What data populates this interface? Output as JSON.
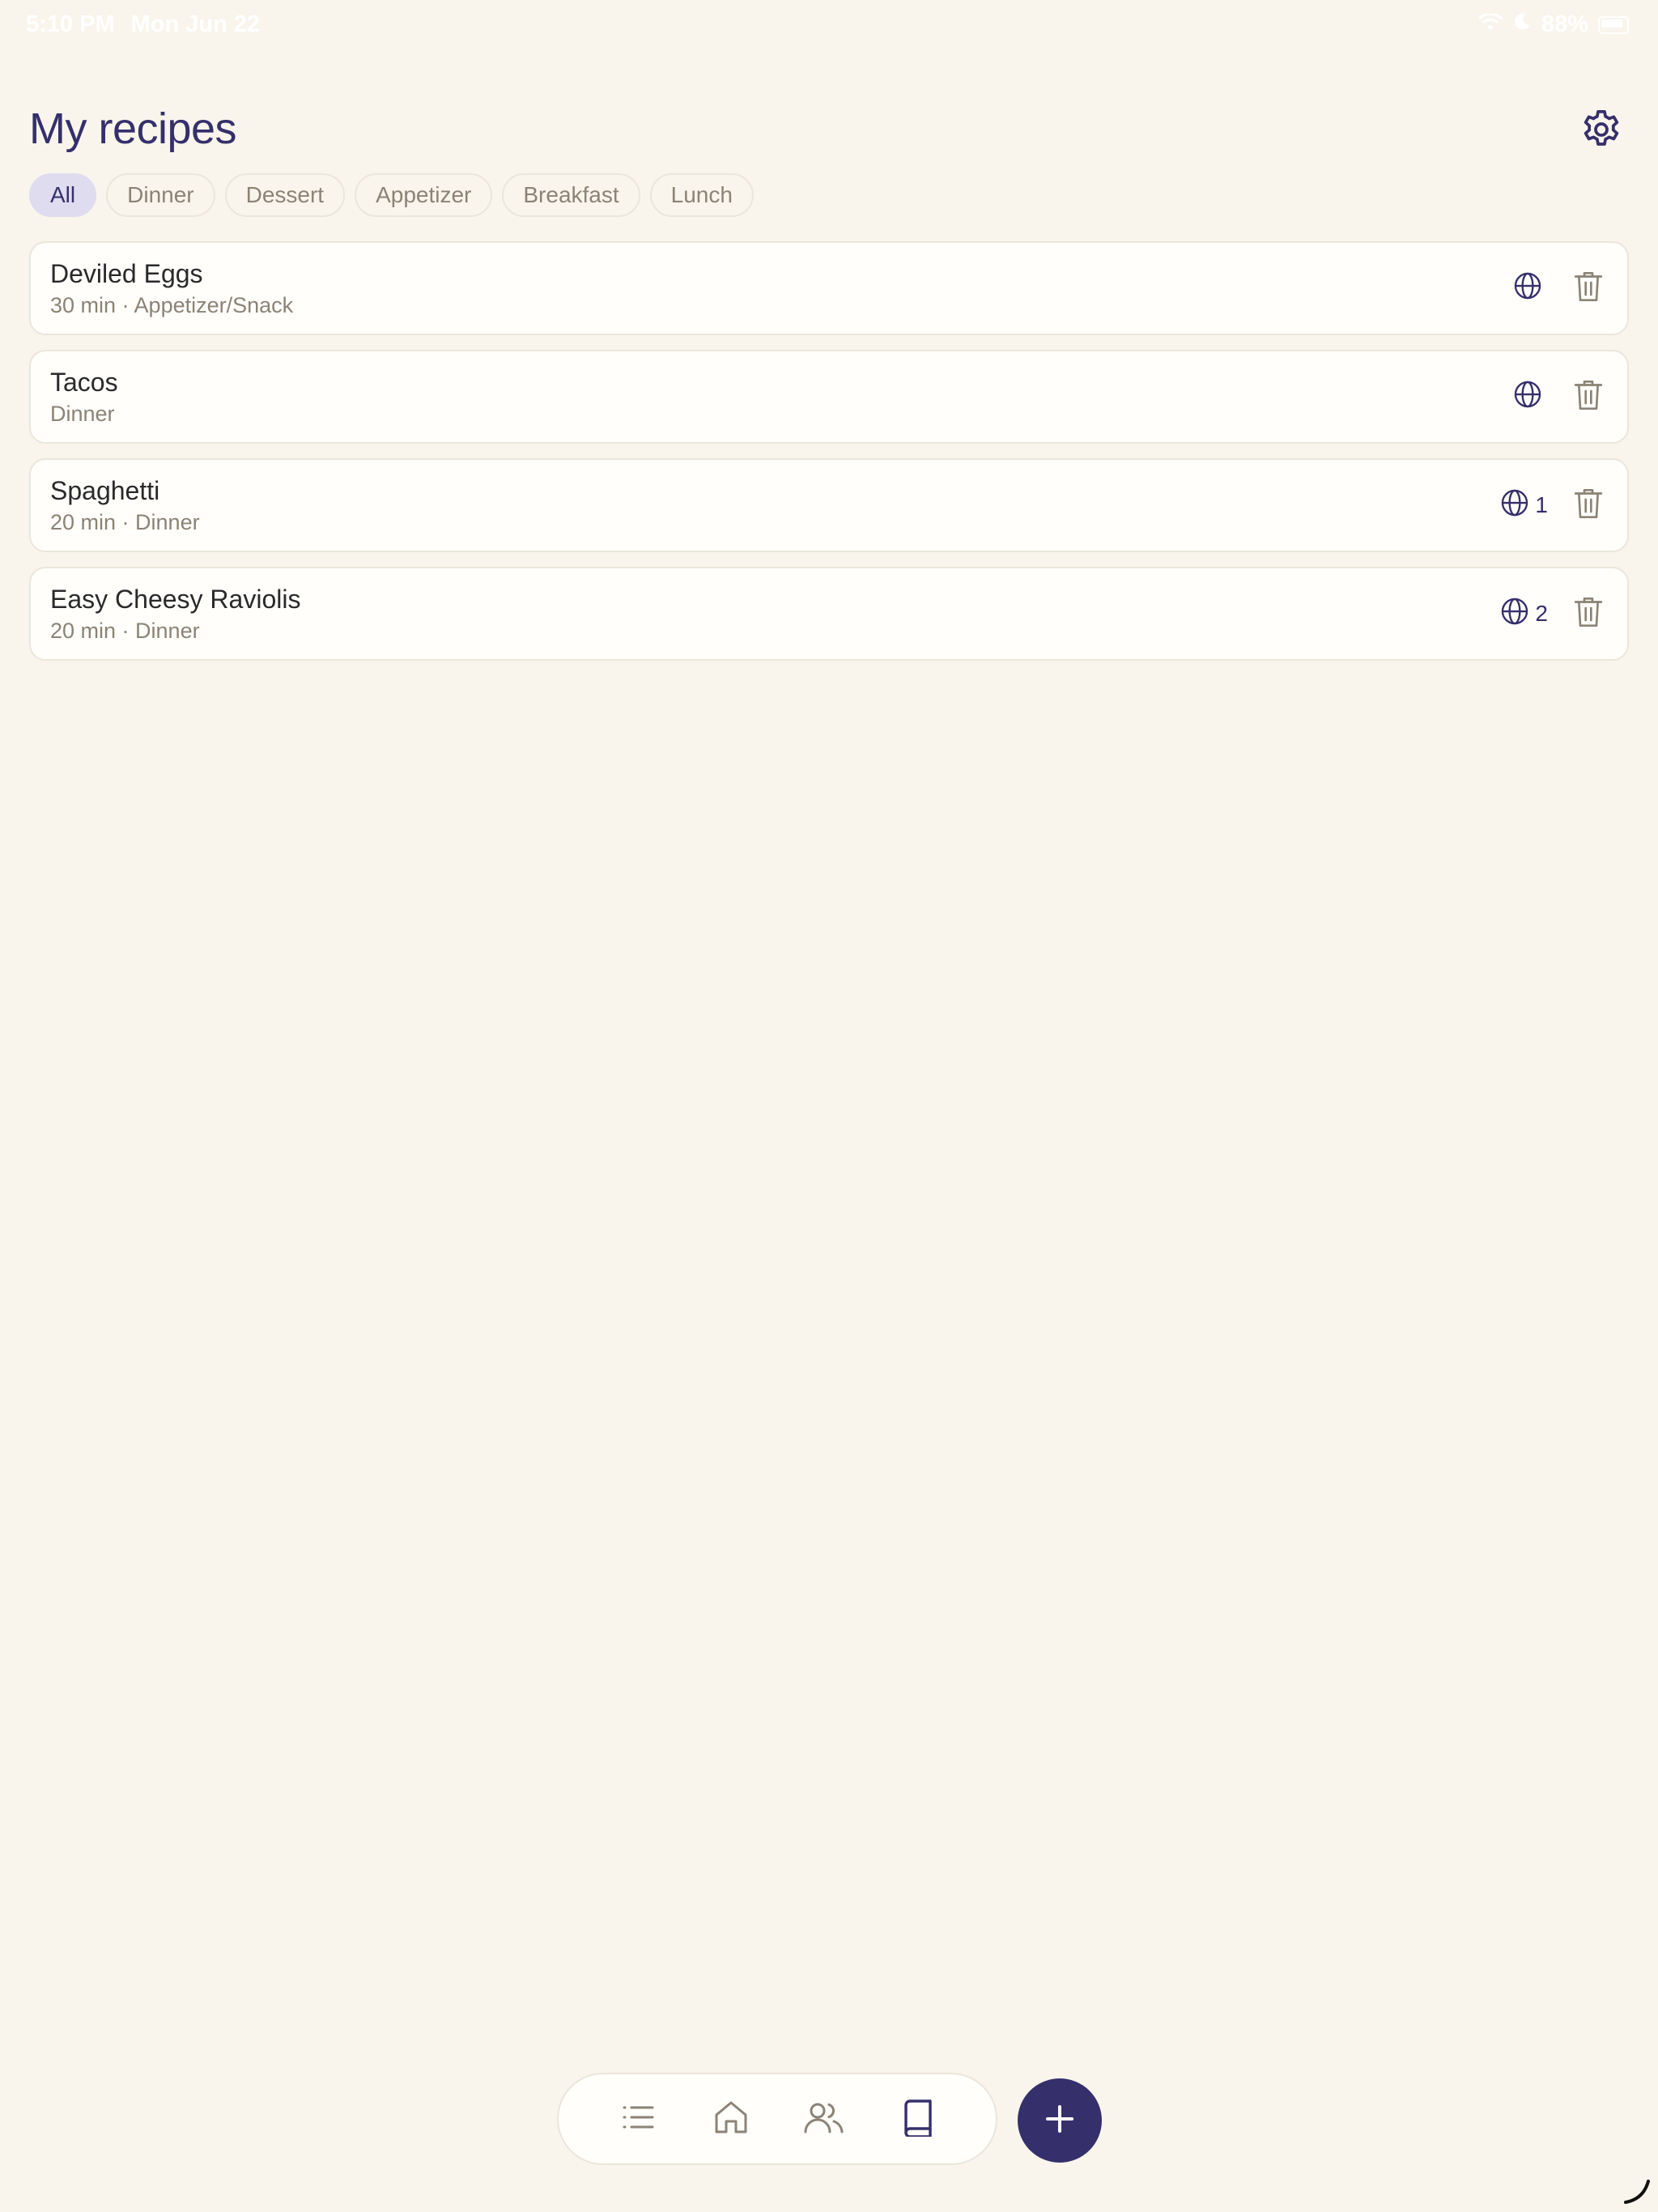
{
  "status_bar": {
    "time": "5:10 PM",
    "date": "Mon Jun 22",
    "battery": "88%",
    "icons": [
      "wifi-icon",
      "moon-icon",
      "battery-icon"
    ]
  },
  "header": {
    "title": "My recipes",
    "settings_icon": "gear-icon"
  },
  "filters": [
    {
      "label": "All",
      "active": true
    },
    {
      "label": "Dinner",
      "active": false
    },
    {
      "label": "Dessert",
      "active": false
    },
    {
      "label": "Appetizer",
      "active": false
    },
    {
      "label": "Breakfast",
      "active": false
    },
    {
      "label": "Lunch",
      "active": false
    }
  ],
  "recipes": [
    {
      "name": "Deviled Eggs",
      "meta": "30 min · Appetizer/Snack",
      "share_count": ""
    },
    {
      "name": "Tacos",
      "meta": "Dinner",
      "share_count": ""
    },
    {
      "name": "Spaghetti",
      "meta": "20 min · Dinner",
      "share_count": "1"
    },
    {
      "name": "Easy Cheesy Raviolis",
      "meta": "20 min · Dinner",
      "share_count": "2"
    }
  ],
  "bottom_nav": {
    "items": [
      {
        "icon": "list-icon",
        "active": false
      },
      {
        "icon": "home-icon",
        "active": false
      },
      {
        "icon": "people-icon",
        "active": false
      },
      {
        "icon": "book-icon",
        "active": true
      }
    ],
    "fab_icon": "plus-icon"
  },
  "colors": {
    "background": "#f9f5ec",
    "accent": "#35306b",
    "muted": "#8b8376",
    "chip_active_bg": "#e0dcf0",
    "card_bg": "#fffefb",
    "border": "#ebe6db"
  }
}
